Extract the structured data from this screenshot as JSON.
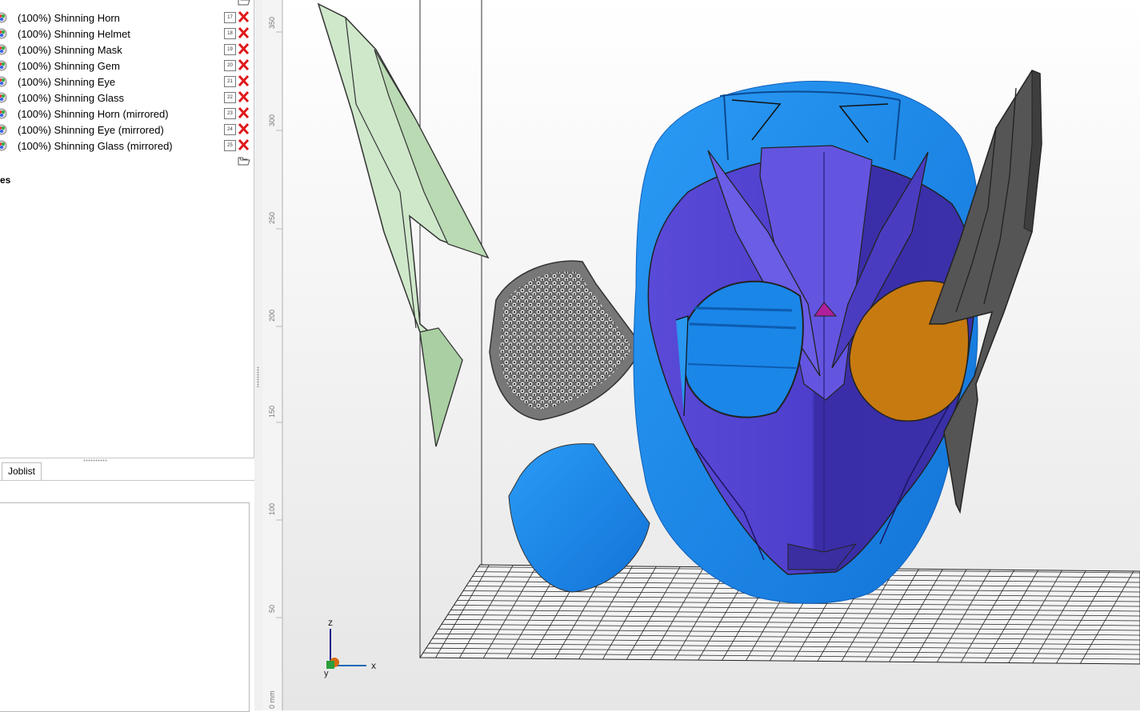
{
  "objects": [
    {
      "label": "(100%) Shinning Horn",
      "number": "17"
    },
    {
      "label": "(100%) Shinning Helmet",
      "number": "18"
    },
    {
      "label": "(100%) Shinning Mask",
      "number": "19"
    },
    {
      "label": "(100%) Shinning Gem",
      "number": "20"
    },
    {
      "label": "(100%) Shinning Eye",
      "number": "21"
    },
    {
      "label": "(100%) Shinning Glass",
      "number": "22"
    },
    {
      "label": "(100%) Shinning Horn (mirrored)",
      "number": "23"
    },
    {
      "label": "(100%) Shinning Eye (mirrored)",
      "number": "24"
    },
    {
      "label": "(100%) Shinning Glass (mirrored)",
      "number": "25"
    }
  ],
  "section_label": "es",
  "tabs": {
    "joblist": "Joblist"
  },
  "ruler": {
    "ticks": [
      "350",
      "300",
      "250",
      "200",
      "150",
      "100",
      "50",
      "0 mm"
    ]
  },
  "axes": {
    "x": "x",
    "y": "y",
    "z": "z"
  },
  "colors": {
    "helmet": "#1f8ef0",
    "mask": "#5b4bd6",
    "eye": "#c97a10",
    "horn_left": "#c9e6c5",
    "horn_right": "#555555",
    "gem": "#b0209a",
    "glass": "#777777",
    "delete": "#e01b1b"
  }
}
